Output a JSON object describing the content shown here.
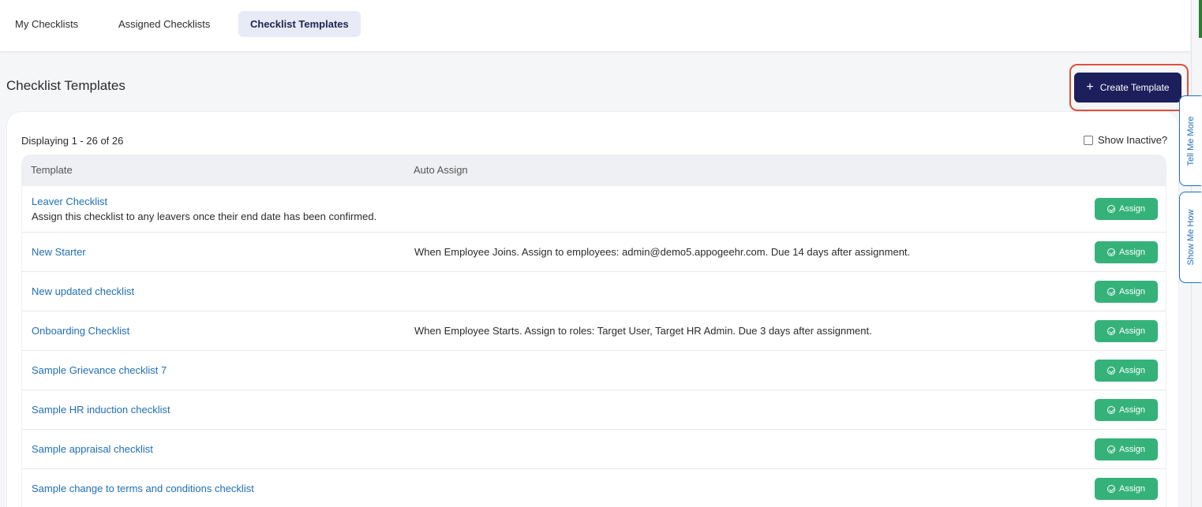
{
  "tabs": [
    {
      "label": "My Checklists"
    },
    {
      "label": "Assigned Checklists"
    },
    {
      "label": "Checklist Templates",
      "active": true
    }
  ],
  "page": {
    "title": "Checklist Templates",
    "create_button": "Create Template",
    "create_icon": "plus-icon"
  },
  "side_tabs": {
    "tell_me_more": "Tell Me More",
    "show_me_how": "Show Me How"
  },
  "table": {
    "display_count": "Displaying 1 - 26 of 26",
    "show_inactive_label": "Show Inactive?",
    "show_inactive_checked": false,
    "headers": {
      "template": "Template",
      "auto_assign": "Auto Assign"
    },
    "assign_label": "Assign",
    "rows": [
      {
        "name": "Leaver Checklist",
        "description": "Assign this checklist to any leavers once their end date has been confirmed.",
        "auto_assign": ""
      },
      {
        "name": "New Starter",
        "description": "",
        "auto_assign": "When Employee Joins. Assign to employees: admin@demo5.appogeehr.com. Due 14 days after assignment."
      },
      {
        "name": "New updated checklist",
        "description": "",
        "auto_assign": ""
      },
      {
        "name": "Onboarding Checklist",
        "description": "",
        "auto_assign": "When Employee Starts. Assign to roles: Target User, Target HR Admin. Due 3 days after assignment."
      },
      {
        "name": "Sample Grievance checklist 7",
        "description": "",
        "auto_assign": ""
      },
      {
        "name": "Sample HR induction checklist",
        "description": "",
        "auto_assign": ""
      },
      {
        "name": "Sample appraisal checklist",
        "description": "",
        "auto_assign": ""
      },
      {
        "name": "Sample change to terms and conditions checklist",
        "description": "",
        "auto_assign": ""
      }
    ]
  },
  "colors": {
    "primary_navy": "#1c1f5c",
    "assign_green": "#35b27a",
    "link_blue": "#1f6eb6",
    "highlight_red": "#e0503c"
  }
}
